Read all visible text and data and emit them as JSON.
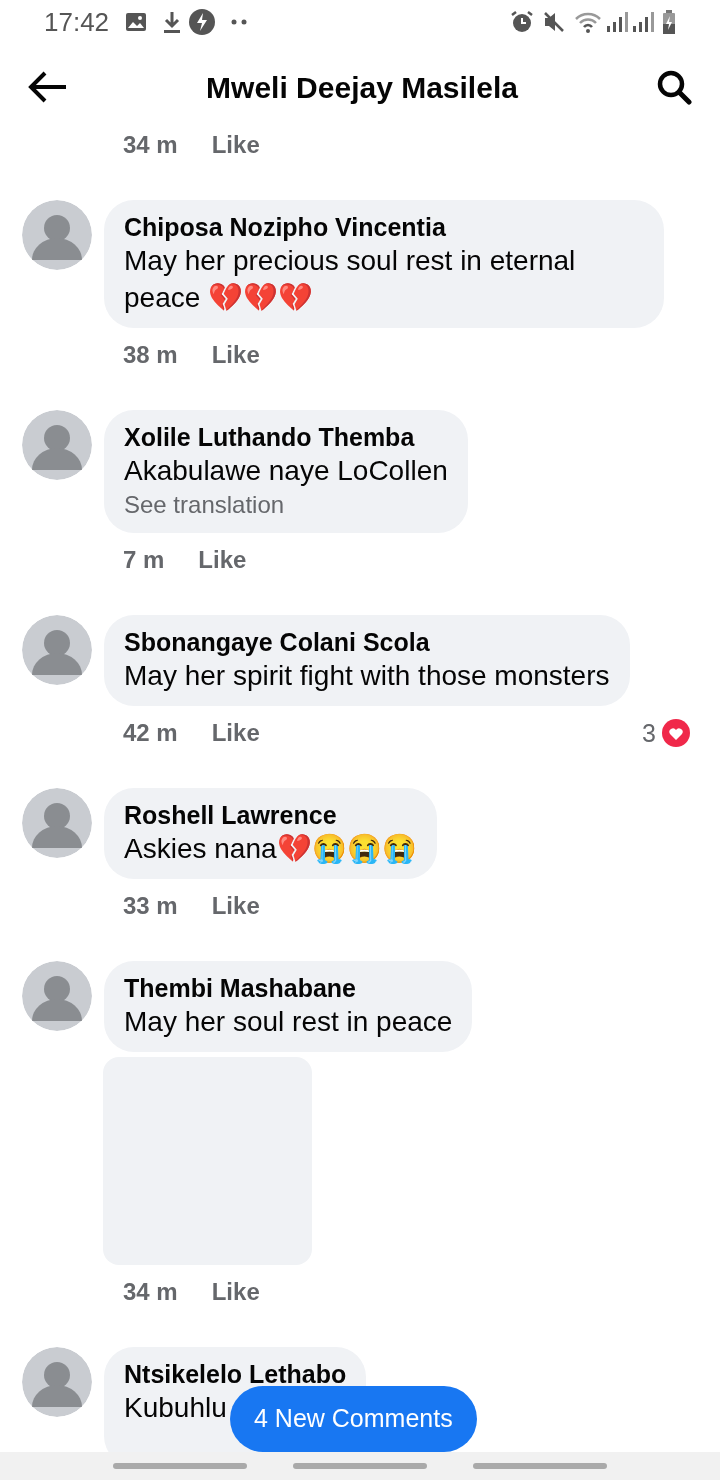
{
  "status_bar": {
    "time": "17:42"
  },
  "header": {
    "title": "Mweli Deejay Masilela"
  },
  "top_meta": {
    "time": "34 m",
    "like": "Like"
  },
  "comments": [
    {
      "name": "Chiposa Nozipho Vincentia",
      "text": "May her precious soul rest in eternal peace 💔💔💔",
      "time": "38 m",
      "like": "Like"
    },
    {
      "name": "Xolile Luthando Themba",
      "text": "Akabulawe naye LoCollen",
      "see_translation": "See translation",
      "time": "7 m",
      "like": "Like"
    },
    {
      "name": "Sbonangaye Colani Scola",
      "text": "May her spirit fight with those monsters",
      "time": "42 m",
      "like": "Like",
      "reactions": {
        "count": "3"
      }
    },
    {
      "name": "Roshell Lawrence",
      "text": "Askies nana💔😭😭😭",
      "time": "33 m",
      "like": "Like"
    },
    {
      "name": "Thembi Mashabane",
      "text": "May her soul rest in peace",
      "attachment": {
        "kind": "placeholder"
      },
      "time": "34 m",
      "like": "Like"
    },
    {
      "name": "Ntsikelelo Lethabo",
      "text": "Kubuhlu"
    }
  ],
  "new_comments_button": "4 New Comments"
}
